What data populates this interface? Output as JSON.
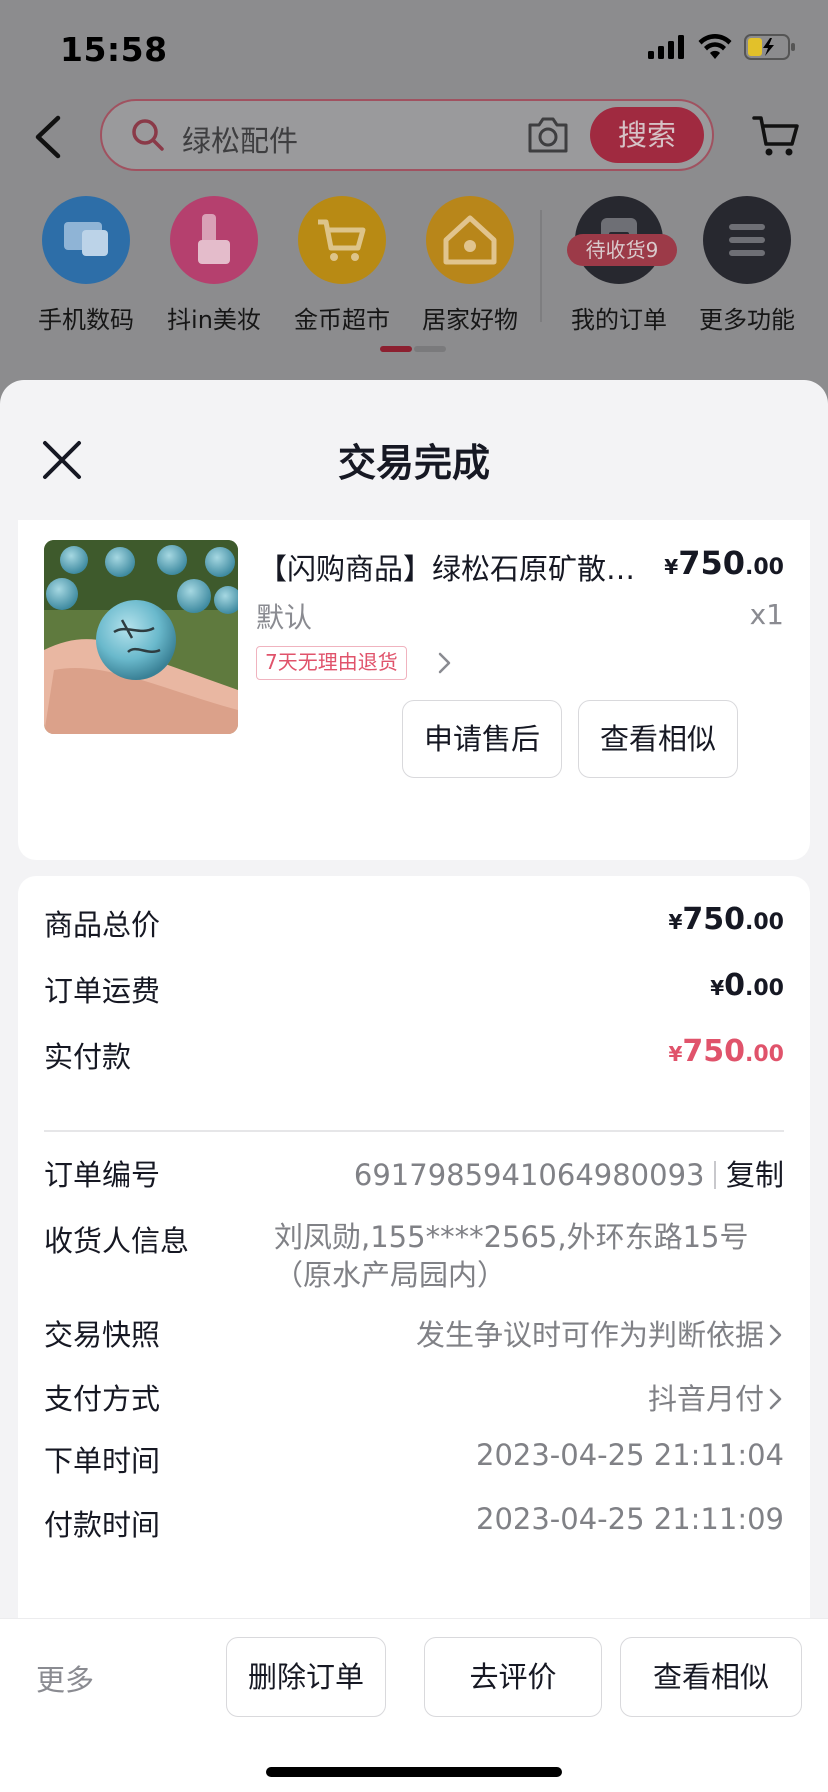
{
  "status_bar": {
    "time": "15:58"
  },
  "search": {
    "placeholder": "绿松配件",
    "button_label": "搜索"
  },
  "quick_nav": [
    {
      "label": "手机数码",
      "icon": "phone-digital-icon",
      "color": "#2d6ea8"
    },
    {
      "label": "抖in美妆",
      "icon": "beauty-icon",
      "color": "#b5406e"
    },
    {
      "label": "金币超市",
      "icon": "cart-icon",
      "color": "#b88a14"
    },
    {
      "label": "居家好物",
      "icon": "home-icon",
      "color": "#b8861a"
    },
    {
      "label": "我的订单",
      "icon": "order-icon",
      "color": "#27282f",
      "badge": "待收货9"
    },
    {
      "label": "更多功能",
      "icon": "menu-icon",
      "color": "#27282f"
    }
  ],
  "sheet": {
    "title": "交易完成",
    "product": {
      "title": "【闪购商品】绿松石原矿散珠圆珠配件",
      "price_yen": "¥",
      "price_int": "750",
      "price_dec": ".00",
      "spec": "默认",
      "qty": "x1",
      "return_tag": "7天无理由退货",
      "btn_after_sale": "申请售后",
      "btn_similar": "查看相似"
    },
    "summary": {
      "total_label": "商品总价",
      "total_int": "750",
      "total_dec": ".00",
      "shipping_label": "订单运费",
      "shipping_int": "0",
      "shipping_dec": ".00",
      "paid_label": "实付款",
      "paid_int": "750",
      "paid_dec": ".00",
      "yen": "¥"
    },
    "info": {
      "order_no_label": "订单编号",
      "order_no": "6917985941064980093",
      "copy": "复制",
      "receiver_label": "收货人信息",
      "receiver": "刘凤勋,155****2565,外环东路15号（原水产局园内）",
      "snapshot_label": "交易快照",
      "snapshot": "发生争议时可作为判断依据",
      "payment_label": "支付方式",
      "payment": "抖音月付",
      "order_time_label": "下单时间",
      "order_time": "2023-04-25 21:11:04",
      "pay_time_label": "付款时间",
      "pay_time": "2023-04-25 21:11:09"
    }
  },
  "actions": {
    "more": "更多",
    "delete": "删除订单",
    "review": "去评价",
    "similar": "查看相似"
  },
  "colors": {
    "accent_red": "#e0536b",
    "sheet_bg": "#f3f3f5"
  }
}
